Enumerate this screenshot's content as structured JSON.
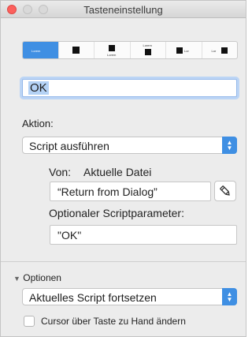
{
  "window": {
    "title": "Tasteneinstellung"
  },
  "style_segments": [
    {
      "label": "Lorem",
      "selected": true
    },
    {
      "label": "",
      "selected": false
    },
    {
      "label": "Lorem",
      "selected": false
    },
    {
      "label": "Lorem",
      "selected": false
    },
    {
      "label": "Lor",
      "selected": false
    },
    {
      "label": "Lor",
      "selected": false
    }
  ],
  "button_title_field": {
    "value": "OK"
  },
  "action": {
    "label": "Aktion:",
    "selected": "Script ausführen",
    "source_prefix": "Von:",
    "source_value": "Aktuelle Datei",
    "script_name": "“Return from Dialog”",
    "param_label": "Optionaler Scriptparameter:",
    "param_value": "\"OK\""
  },
  "options": {
    "disclosure_label": "Optionen",
    "selected": "Aktuelles Script fortsetzen",
    "checkbox_label": "Cursor über Taste zu Hand ändern",
    "checkbox_checked": false
  },
  "colors": {
    "accent": "#3f8fe3",
    "close": "#fc605c",
    "selection": "#b4d2f5"
  }
}
